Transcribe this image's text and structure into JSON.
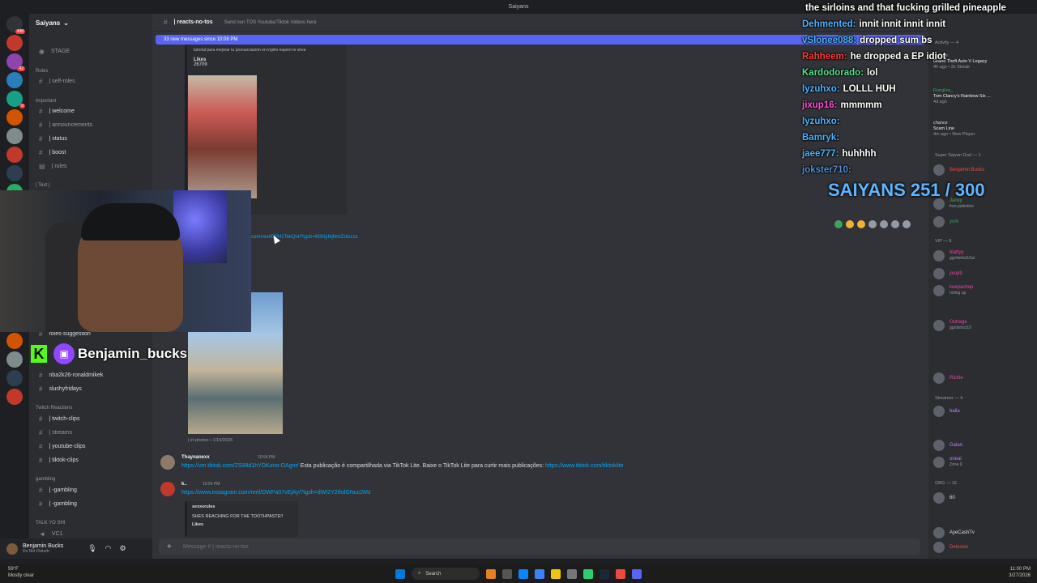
{
  "window": {
    "title": "Saiyans"
  },
  "server": {
    "name": "Saiyans"
  },
  "sidebar": {
    "stage": "STAGE",
    "cat_roles": "Roles",
    "self_roles": "| self-roles",
    "cat_important": "Important",
    "welcome": "| welcome",
    "announcements": "| announcements",
    "status": "| status",
    "boost": "| boost",
    "rules": "| rules",
    "text_cat": "| Text |",
    "roles_suggestion": "roles-suggestion",
    "nba": "nba2k26-ronaldmikek",
    "slushy": "slushyfridays",
    "cat_twitch": "Twitch Reactions",
    "twitch_clips": "| twitch-clips",
    "streams": "| streams",
    "youtube_clips": "| youtube-clips",
    "tiktok_clips": "| tiktok-clips",
    "cat_gambling": "gambling",
    "gambling1": "| -gambling",
    "gambling2": "| -gambling",
    "cat_talk": "TALK YO SHI",
    "vc": "VC1"
  },
  "user": {
    "name": "Benjamin Bucks",
    "status": "Do Not Disturb"
  },
  "channel": {
    "name": "| reacts-no-tos",
    "topic": "Send non TOS Youtube/Tiktok Videos here"
  },
  "banner": {
    "new_messages": "33 new messages since 10:08 PM"
  },
  "messages": {
    "embed1_text": "tutorial para mejorar tu pronunciación en inglés espero te sirva",
    "embed1_likes_label": "Likes",
    "embed1_likes": "26709",
    "link_partial": "com/reel/DPH1TekQvt/?igsh=M3NyMjNmZzlicczx",
    "photo_caption": "| irl-photos • 1/15/2026",
    "m1_name": "Thaynanexx",
    "m1_time": "10:54 PM",
    "m1_link": "https://vm.tiktok.com/ZS98d1hYDKuno-OAgnr/",
    "m1_text": "Esta publicação é compartilhada via TikTok Lite. Baixe o TikTok Lite para curtir mais publicações:",
    "m1_link2": "https://www.tiktok.com/tiktoklite",
    "m2_name": "k..",
    "m2_time": "10:54 PM",
    "m2_link": "https://www.instagram.com/reel/DWPa07vEjAy/?igsh=dWI2Y2thdGNuc2Mz",
    "m2_embed_author": "sexxerules",
    "m2_embed_text": "SHES REACHING FOR THE TOOTHPASTE!!",
    "m2_embed_likes": "Likes"
  },
  "input": {
    "placeholder": "Message # | reacts-no-tos"
  },
  "members": {
    "activity": "Activity — 4",
    "a1_name": "chance",
    "a1_game": "Grand Theft Auto V Legacy",
    "a1_sub": "4h ago • 3x Streak",
    "a2_name": "Ranglins_",
    "a2_game": "Tom Clancy's Rainbow Six ...",
    "a2_sub": "4d ago",
    "a3_name": "chance",
    "a3_game": "Scam Line",
    "a3_sub": "4m ago • New Player",
    "god": "Super Saiyan God — 1",
    "god1": "Benjamin Bucks",
    "g2": "Janxy",
    "g2_sub": "free palestine",
    "g3": "yurk",
    "vip": "VIP — 8",
    "v1": "blattyy",
    "v1_sub": "gg/district10al",
    "v2": "jixup9",
    "v3": "keepachop",
    "v3_sub": "rolling up",
    "v4": "Outrage",
    "v4_sub": "gg/district10",
    "v5": "Richie",
    "streamer": "Streamer — 4",
    "s1": "balla",
    "s2": "Galan",
    "s3": "oneal",
    "s3_sub": "Zone 9",
    "gbg": "GBG — 16",
    "g_1": "60",
    "g_2": "AyeCashTv",
    "g_3": "Delusive"
  },
  "stream_overlay": {
    "kick_letter": "K",
    "twitch_name": "Benjamin_bucks",
    "counter": "SAIYANS 251 / 300",
    "chat": [
      {
        "user": "",
        "text": "the sirloins and that fucking grilled pineapple",
        "color": "#ffffff"
      },
      {
        "user": "Dehmented:",
        "text": "innit innit innit innit",
        "color": "#4fb3ff"
      },
      {
        "user": "vSlonee088:",
        "text": "dropped sum bs",
        "color": "#4fb3ff"
      },
      {
        "user": "Rahheem:",
        "text": "he dropped a EP idiot",
        "color": "#ff3b3b"
      },
      {
        "user": "Kardodorado:",
        "text": "lol",
        "color": "#56e08a"
      },
      {
        "user": "lyzuhxo:",
        "text": "LOLLL HUH",
        "color": "#4fb3ff"
      },
      {
        "user": "jixup16:",
        "text": "mmmmm",
        "color": "#ff4fd8"
      },
      {
        "user": "lyzuhxo:",
        "text": "",
        "color": "#4fb3ff"
      },
      {
        "user": "Bamryk:",
        "text": "",
        "color": "#4fb3ff"
      },
      {
        "user": "jaee777:",
        "text": "huhhhh",
        "color": "#4fb3ff"
      },
      {
        "user": "jokster710:",
        "text": "",
        "color": "#4f8fd6"
      }
    ]
  },
  "taskbar": {
    "weather": "59°F",
    "weather_sub": "Mostly clear",
    "search": "Search",
    "time": "11:00 PM",
    "date": "3/27/2026"
  }
}
